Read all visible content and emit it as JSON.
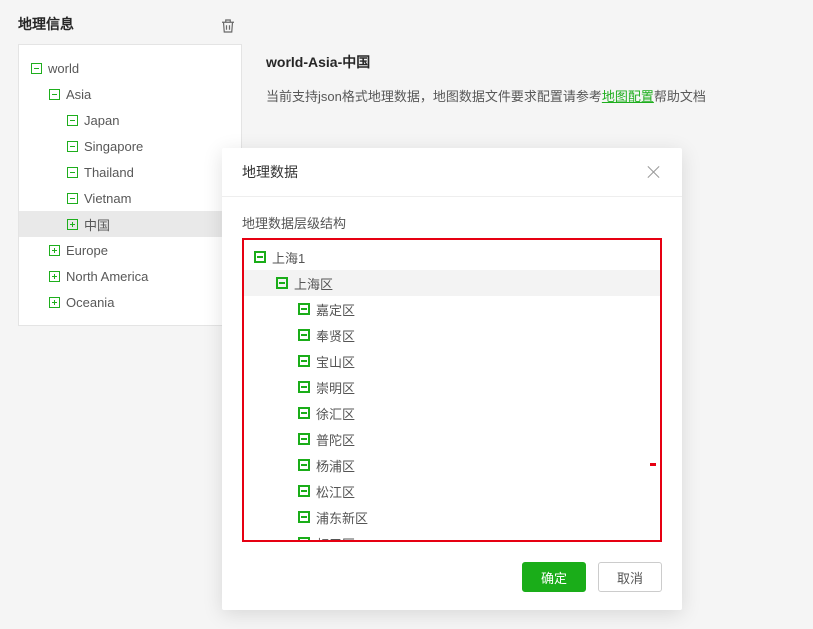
{
  "page": {
    "title": "地理信息"
  },
  "sidebar": {
    "tree": [
      {
        "label": "world",
        "depth": 0,
        "icon": "minus",
        "selected": false
      },
      {
        "label": "Asia",
        "depth": 1,
        "icon": "minus",
        "selected": false
      },
      {
        "label": "Japan",
        "depth": 2,
        "icon": "minus",
        "selected": false
      },
      {
        "label": "Singapore",
        "depth": 2,
        "icon": "minus",
        "selected": false
      },
      {
        "label": "Thailand",
        "depth": 2,
        "icon": "minus",
        "selected": false
      },
      {
        "label": "Vietnam",
        "depth": 2,
        "icon": "minus",
        "selected": false
      },
      {
        "label": "中国",
        "depth": 2,
        "icon": "plus",
        "selected": true
      },
      {
        "label": "Europe",
        "depth": 1,
        "icon": "plus",
        "selected": false
      },
      {
        "label": "North America",
        "depth": 1,
        "icon": "plus",
        "selected": false
      },
      {
        "label": "Oceania",
        "depth": 1,
        "icon": "plus",
        "selected": false
      }
    ]
  },
  "main": {
    "breadcrumb": "world-Asia-中国",
    "info_prefix": "当前支持json格式地理数据，地图数据文件要求配置请参考",
    "info_link": "地图配置",
    "info_suffix": "帮助文档"
  },
  "modal": {
    "title": "地理数据",
    "sub_label": "地理数据层级结构",
    "tree": [
      {
        "label": "上海1",
        "depth": 0,
        "selected": false
      },
      {
        "label": "上海区",
        "depth": 1,
        "selected": true
      },
      {
        "label": "嘉定区",
        "depth": 2,
        "selected": false
      },
      {
        "label": "奉贤区",
        "depth": 2,
        "selected": false
      },
      {
        "label": "宝山区",
        "depth": 2,
        "selected": false
      },
      {
        "label": "崇明区",
        "depth": 2,
        "selected": false
      },
      {
        "label": "徐汇区",
        "depth": 2,
        "selected": false
      },
      {
        "label": "普陀区",
        "depth": 2,
        "selected": false
      },
      {
        "label": "杨浦区",
        "depth": 2,
        "selected": false
      },
      {
        "label": "松江区",
        "depth": 2,
        "selected": false
      },
      {
        "label": "浦东新区",
        "depth": 2,
        "selected": false
      },
      {
        "label": "虹口区",
        "depth": 2,
        "selected": false
      }
    ],
    "ok_label": "确定",
    "cancel_label": "取消"
  }
}
